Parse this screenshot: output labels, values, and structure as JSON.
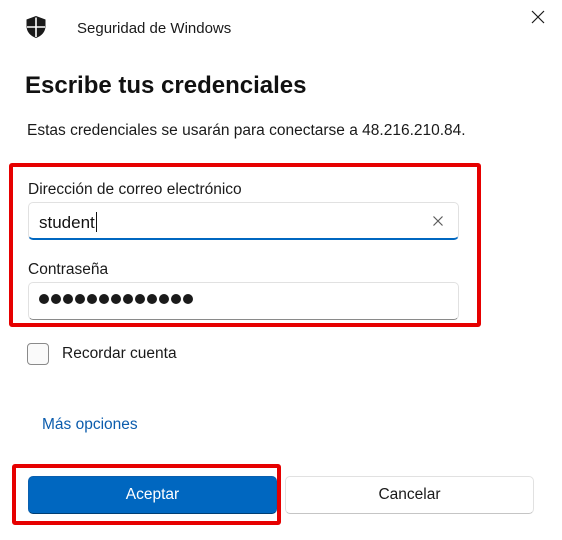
{
  "window": {
    "app_title": "Seguridad de Windows",
    "icons": {
      "app": "shield-icon",
      "close": "close-icon"
    }
  },
  "dialog": {
    "heading": "Escribe tus credenciales",
    "description": "Estas credenciales se usarán para conectarse a 48.216.210.84."
  },
  "form": {
    "email": {
      "label": "Dirección de correo electrónico",
      "value": "student",
      "focused": true,
      "clear_icon": "clear-x-icon"
    },
    "password": {
      "label": "Contraseña",
      "masked_length": 13
    },
    "remember": {
      "label": "Recordar cuenta",
      "checked": false
    }
  },
  "links": {
    "more_options": "Más opciones"
  },
  "buttons": {
    "accept": "Aceptar",
    "cancel": "Cancelar"
  },
  "colors": {
    "accent": "#0067c0",
    "link": "#0b5cad",
    "highlight": "#e60000"
  }
}
